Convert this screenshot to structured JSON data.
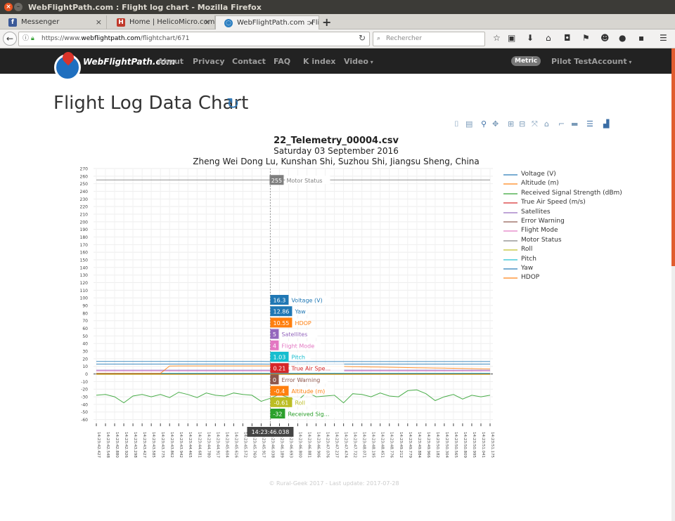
{
  "window": {
    "title": "WebFlightPath.com : Flight log chart - Mozilla Firefox"
  },
  "tabs": [
    {
      "label": "Messenger",
      "icon": "messenger-icon",
      "color": "#3b5998",
      "glyph": "f"
    },
    {
      "label": "Home | HelicoMicro.com",
      "icon": "helicomicro-icon",
      "color": "#c0392b",
      "glyph": "H"
    },
    {
      "label": "WebFlightPath.com : Flight log",
      "icon": "globe-icon",
      "color": "#2d7fc1",
      "glyph": "●"
    }
  ],
  "toolbar": {
    "url_prefix": "https://www.",
    "url_host": "webflightpath.com",
    "url_path": "/flightchart/671",
    "search_placeholder": "Rechercher"
  },
  "site": {
    "brand": "WebFlightPath.com",
    "nav": [
      "About",
      "Privacy",
      "Contact",
      "FAQ",
      "K index",
      "Video"
    ],
    "metric_badge": "Metric",
    "account": "Pilot TestAccount"
  },
  "page": {
    "title": "Flight Log Data Chart",
    "footer": "© Rural-Geek 2017 - Last update: 2017-07-28"
  },
  "chart_data": {
    "type": "line",
    "title": "22_Telemetry_00004.csv",
    "subtitle1": "Saturday 03 September 2016",
    "subtitle2": "Zheng Wei Dong Lu, Kunshan Shi, Suzhou Shi, Jiangsu Sheng, China",
    "ylim": [
      -65,
      270
    ],
    "yticks": [
      -60,
      -50,
      -40,
      -30,
      -20,
      -10,
      0,
      10,
      20,
      30,
      40,
      50,
      60,
      70,
      80,
      90,
      100,
      110,
      120,
      130,
      140,
      150,
      160,
      170,
      180,
      190,
      200,
      210,
      220,
      230,
      240,
      250,
      260,
      270
    ],
    "xticks": [
      "14:23:42.427",
      "14:23:42.548",
      "14:23:42.880",
      "14:23:42.926",
      "14:23:43.298",
      "14:23:43.427",
      "14:23:43.585",
      "14:23:43.775",
      "14:23:43.862",
      "14:23:43.942",
      "14:23:44.465",
      "14:23:44.681",
      "14:23:44.780",
      "14:23:44.917",
      "14:23:45.604",
      "14:23:45.616",
      "14:23:45.572",
      "14:23:45.760",
      "14:23:45.917",
      "14:23:46.038",
      "14:23:46.189",
      "14:23:46.693",
      "14:23:46.800",
      "14:23:46.881",
      "14:23:46.906",
      "14:23:47.076",
      "14:23:47.237",
      "14:23:47.474",
      "14:23:47.722",
      "14:23:48.071",
      "14:23:48.195",
      "14:23:48.451",
      "14:23:48.776",
      "14:23:49.212",
      "14:23:49.779",
      "14:23:49.884",
      "14:23:49.966",
      "14:23:50.182",
      "14:23:50.304",
      "14:23:50.565",
      "14:23:50.809",
      "14:23:50.995",
      "14:23:51.041",
      "14:23:51.175"
    ],
    "hover_x": "14:23:46.038",
    "hover_index": 19,
    "series": [
      {
        "name": "Voltage (V)",
        "color": "#1f77b4",
        "label_color": "#1f77b4",
        "hover": "16.3",
        "values": [
          16.4,
          16.4,
          16.4,
          16.4,
          16.4,
          16.4,
          16.4,
          16.4,
          16.4,
          16.4,
          16.4,
          16.4,
          16.4,
          16.4,
          16.4,
          16.4,
          16.4,
          16.4,
          16.4,
          16.3,
          16.3,
          16.3,
          16.3,
          16.3,
          16.3,
          16.3,
          16.3,
          16.3,
          16.3,
          16.3,
          16.3,
          16.3,
          16.3,
          16.3,
          16.3,
          16.3,
          16.3,
          16.3,
          16.3,
          16.3,
          16.3,
          16.3,
          16.3,
          16.3
        ]
      },
      {
        "name": "Altitude (m)",
        "color": "#ff7f0e",
        "label_color": "#ff7f0e",
        "hover": "-0.4",
        "values": [
          -0.4,
          -0.4,
          -0.4,
          -0.4,
          -0.4,
          -0.4,
          -0.4,
          -0.4,
          -0.4,
          -0.4,
          -0.4,
          -0.4,
          -0.4,
          -0.4,
          -0.4,
          -0.4,
          -0.4,
          -0.4,
          -0.4,
          -0.4,
          -0.4,
          -0.4,
          -0.4,
          -0.4,
          -0.4,
          -0.4,
          -0.4,
          -0.4,
          -0.4,
          -0.4,
          -0.4,
          -0.4,
          -0.4,
          -0.4,
          -0.4,
          -0.4,
          -0.4,
          -0.4,
          -0.4,
          -0.4,
          -0.4,
          -0.4,
          -0.4,
          -0.4
        ]
      },
      {
        "name": "Received Signal Strength (dBm)",
        "color": "#2ca02c",
        "label_color": "#2ca02c",
        "hover": "-32",
        "label": "Received Sig...",
        "values": [
          -28,
          -27,
          -30,
          -38,
          -29,
          -27,
          -30,
          -27,
          -31,
          -24,
          -27,
          -31,
          -25,
          -28,
          -29,
          -25,
          -27,
          -28,
          -36,
          -32,
          -27,
          -31,
          -35,
          -24,
          -30,
          -29,
          -28,
          -38,
          -26,
          -27,
          -30,
          -25,
          -29,
          -30,
          -22,
          -21,
          -26,
          -35,
          -30,
          -27,
          -33,
          -28,
          -30,
          -28
        ]
      },
      {
        "name": "True Air Speed (m/s)",
        "color": "#d62728",
        "label_color": "#d62728",
        "hover": "0.21",
        "label": "True Air Spe...",
        "values": [
          0.2,
          0.2,
          0.2,
          0.2,
          0.2,
          0.2,
          0.2,
          0.2,
          0.2,
          0.2,
          0.2,
          0.2,
          0.2,
          0.2,
          0.2,
          0.2,
          0.2,
          0.2,
          0.2,
          0.21,
          0.2,
          0.2,
          0.2,
          0.2,
          0.2,
          0.2,
          0.2,
          0.2,
          0.2,
          0.2,
          0.2,
          0.2,
          0.2,
          0.2,
          0.2,
          0.2,
          0.2,
          0.2,
          0.2,
          0.2,
          0.2,
          0.2,
          0.2,
          0.2
        ]
      },
      {
        "name": "Satellites",
        "color": "#9467bd",
        "label_color": "#9467bd",
        "hover": "5",
        "values": [
          5,
          5,
          5,
          5,
          5,
          5,
          5,
          5,
          5,
          5,
          5,
          5,
          5,
          5,
          5,
          5,
          5,
          5,
          5,
          5,
          5,
          5,
          5,
          5,
          5,
          5,
          5,
          5,
          5,
          5,
          5,
          5,
          5,
          5,
          5,
          5,
          5,
          5,
          5,
          5,
          5,
          5,
          5,
          5
        ]
      },
      {
        "name": "Error Warning",
        "color": "#8c564b",
        "label_color": "#8c564b",
        "hover": "0",
        "values": [
          0,
          0,
          0,
          0,
          0,
          0,
          0,
          0,
          0,
          0,
          0,
          0,
          0,
          0,
          0,
          0,
          0,
          0,
          0,
          0,
          0,
          0,
          0,
          0,
          0,
          0,
          0,
          0,
          0,
          0,
          0,
          0,
          0,
          0,
          0,
          0,
          0,
          0,
          0,
          0,
          0,
          0,
          0,
          0
        ]
      },
      {
        "name": "Flight Mode",
        "color": "#e377c2",
        "label_color": "#e377c2",
        "hover": "4",
        "values": [
          4,
          4,
          4,
          4,
          4,
          4,
          4,
          4,
          4,
          4,
          4,
          4,
          4,
          4,
          4,
          4,
          4,
          4,
          4,
          4,
          4,
          4,
          4,
          4,
          4,
          4,
          4,
          4,
          4,
          4,
          4,
          4,
          4,
          4,
          4,
          4,
          4,
          4,
          4,
          4,
          4,
          4,
          4,
          4
        ]
      },
      {
        "name": "Motor Status",
        "color": "#7f7f7f",
        "label_color": "#7f7f7f",
        "hover": "255",
        "values": [
          255,
          255,
          255,
          255,
          255,
          255,
          255,
          255,
          255,
          255,
          255,
          255,
          255,
          255,
          255,
          255,
          255,
          255,
          255,
          255,
          255,
          255,
          255,
          255,
          255,
          255,
          255,
          255,
          255,
          255,
          255,
          255,
          255,
          255,
          255,
          255,
          255,
          255,
          255,
          255,
          255,
          255,
          255,
          255
        ]
      },
      {
        "name": "Roll",
        "color": "#bcbd22",
        "label_color": "#bcbd22",
        "hover": "-0.61",
        "values": [
          -0.6,
          -0.6,
          -0.6,
          -0.6,
          -0.6,
          -0.6,
          -0.6,
          -0.6,
          -0.6,
          -0.6,
          -0.6,
          -0.6,
          -0.6,
          -0.6,
          -0.6,
          -0.6,
          -0.6,
          -0.6,
          -0.6,
          -0.61,
          -0.6,
          -0.6,
          -0.6,
          -0.6,
          -0.6,
          -0.6,
          -0.6,
          -0.6,
          -0.6,
          -0.6,
          -0.6,
          -0.6,
          -0.6,
          -0.6,
          -0.6,
          -0.6,
          -0.6,
          -0.6,
          -0.6,
          -0.6,
          -0.6,
          -0.6,
          -0.6,
          -0.6
        ]
      },
      {
        "name": "Pitch",
        "color": "#17becf",
        "label_color": "#17becf",
        "hover": "1.03",
        "values": [
          1,
          1,
          1,
          1,
          1,
          1,
          1,
          1,
          1,
          1,
          1,
          1,
          1,
          1,
          1,
          1,
          1,
          1,
          1,
          1.03,
          1,
          1,
          1,
          1,
          1,
          1,
          1,
          1,
          1,
          1,
          1,
          1,
          1,
          1,
          1,
          1,
          1,
          1,
          1,
          1,
          1,
          1,
          1,
          1
        ]
      },
      {
        "name": "Yaw",
        "color": "#1f77b4",
        "label_color": "#1f77b4",
        "hover": "12.86",
        "values": [
          13,
          13,
          13,
          13,
          13,
          13,
          13,
          13,
          13,
          13,
          13,
          13,
          13,
          13,
          13,
          13,
          13,
          13,
          13,
          12.86,
          13,
          13,
          13,
          13,
          13,
          13,
          13,
          13,
          13,
          13,
          13,
          13,
          13,
          13,
          13,
          13,
          13,
          13,
          13,
          13,
          13,
          13,
          13,
          13
        ]
      },
      {
        "name": "HDOP",
        "color": "#ff7f0e",
        "label_color": "#ff7f0e",
        "hover": "10.55",
        "values": [
          0.8,
          0.8,
          0.8,
          0.8,
          0.8,
          0.8,
          0.8,
          0.8,
          10.5,
          10.6,
          10.6,
          10.6,
          10.6,
          10.6,
          10.6,
          10.6,
          10.6,
          10.6,
          10.6,
          10.55,
          10.5,
          10.5,
          10.5,
          10.4,
          10.3,
          10.2,
          10,
          9.8,
          9.6,
          9.4,
          9.2,
          9,
          8.8,
          8.6,
          8.4,
          8.2,
          8,
          7.8,
          7.6,
          7.4,
          7.2,
          7,
          6.8,
          6.6
        ]
      }
    ],
    "hover_order": [
      "Voltage (V)",
      "Yaw",
      "HDOP",
      "Satellites",
      "Flight Mode",
      "Pitch",
      "True Air Speed (m/s)",
      "Error Warning",
      "Altitude (m)",
      "Roll",
      "Received Signal Strength (dBm)"
    ],
    "legend_position": "right",
    "grid": true
  }
}
